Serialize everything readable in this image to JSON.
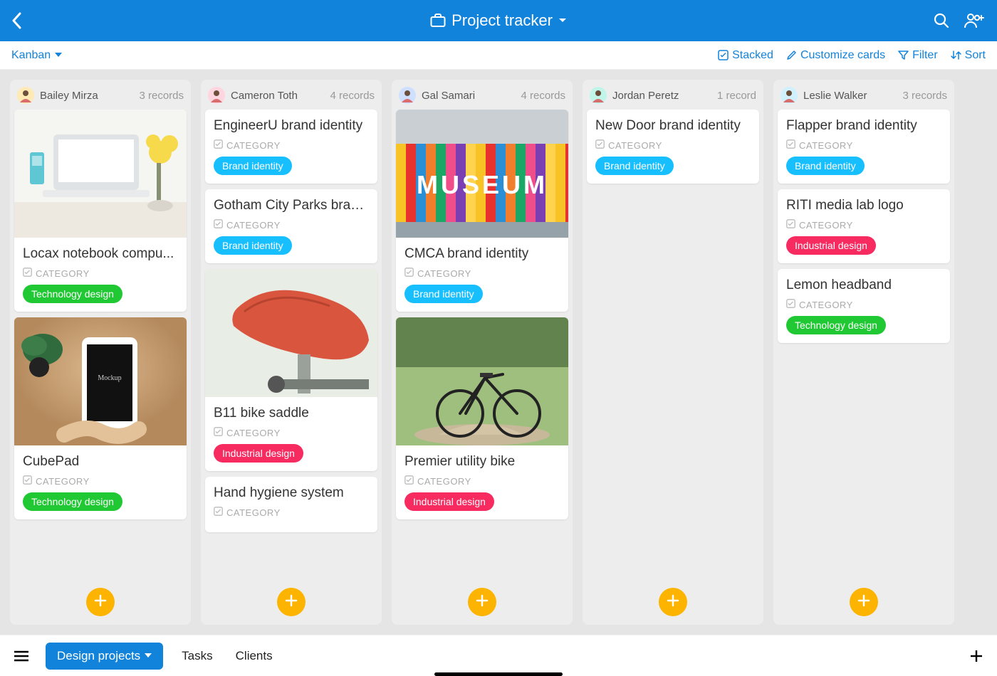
{
  "header": {
    "title": "Project tracker"
  },
  "viewbar": {
    "view_name": "Kanban",
    "stacked": "Stacked",
    "customize": "Customize cards",
    "filter": "Filter",
    "sort": "Sort"
  },
  "category_label": "CATEGORY",
  "tags": {
    "brand_identity": {
      "label": "Brand identity",
      "color": "#18bfff"
    },
    "technology_design": {
      "label": "Technology design",
      "color": "#20c933"
    },
    "industrial_design": {
      "label": "Industrial design",
      "color": "#f82b60"
    }
  },
  "columns": [
    {
      "person": "Bailey Mirza",
      "avatar_bg": "#ffeab6",
      "count_label": "3 records",
      "cards": [
        {
          "title": "Locax notebook compu...",
          "tag": "technology_design",
          "image": "laptop"
        },
        {
          "title": "CubePad",
          "tag": "technology_design",
          "image": "tablet"
        }
      ]
    },
    {
      "person": "Cameron Toth",
      "avatar_bg": "#ffd6e0",
      "count_label": "4 records",
      "cards": [
        {
          "title": "EngineerU brand identity",
          "tag": "brand_identity"
        },
        {
          "title": "Gotham City Parks bran...",
          "tag": "brand_identity"
        },
        {
          "title": "B11 bike saddle",
          "tag": "industrial_design",
          "image": "saddle"
        },
        {
          "title": "Hand hygiene system"
        }
      ]
    },
    {
      "person": "Gal Samari",
      "avatar_bg": "#cfdfff",
      "count_label": "4 records",
      "cards": [
        {
          "title": "CMCA brand identity",
          "tag": "brand_identity",
          "image": "museum"
        },
        {
          "title": "Premier utility bike",
          "tag": "industrial_design",
          "image": "bike"
        }
      ]
    },
    {
      "person": "Jordan Peretz",
      "avatar_bg": "#c2f5e9",
      "count_label": "1 record",
      "cards": [
        {
          "title": "New Door brand identity",
          "tag": "brand_identity"
        }
      ]
    },
    {
      "person": "Leslie Walker",
      "avatar_bg": "#d0f0fd",
      "count_label": "3 records",
      "cards": [
        {
          "title": "Flapper brand identity",
          "tag": "brand_identity"
        },
        {
          "title": "RITI media lab logo",
          "tag": "industrial_design"
        },
        {
          "title": "Lemon headband",
          "tag": "technology_design"
        }
      ]
    }
  ],
  "tabs": {
    "active": "Design projects",
    "others": [
      "Tasks",
      "Clients"
    ]
  }
}
